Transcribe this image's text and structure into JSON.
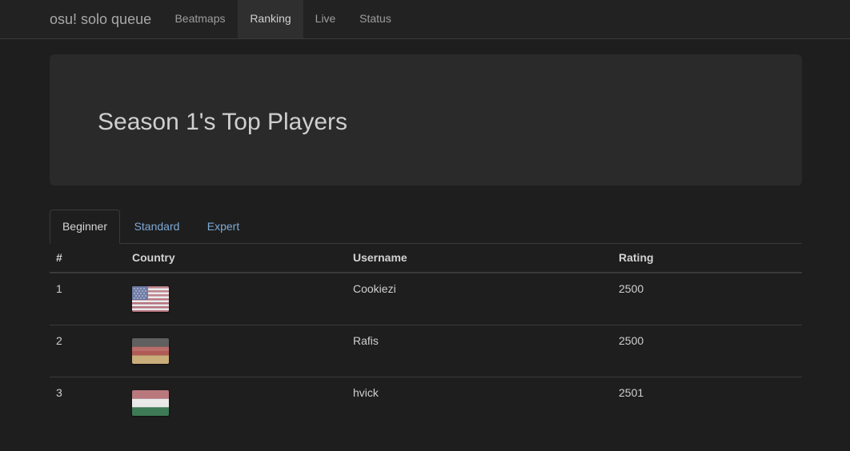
{
  "navbar": {
    "brand": "osu! solo queue",
    "items": [
      {
        "label": "Beatmaps",
        "active": false
      },
      {
        "label": "Ranking",
        "active": true
      },
      {
        "label": "Live",
        "active": false
      },
      {
        "label": "Status",
        "active": false
      }
    ]
  },
  "jumbotron": {
    "title": "Season 1's Top Players"
  },
  "tabs": [
    {
      "label": "Beginner",
      "active": true
    },
    {
      "label": "Standard",
      "active": false
    },
    {
      "label": "Expert",
      "active": false
    }
  ],
  "table": {
    "headers": [
      "#",
      "Country",
      "Username",
      "Rating"
    ],
    "rows": [
      {
        "rank": "1",
        "country_flag": "us-flag-icon",
        "username": "Cookiezi",
        "rating": "2500"
      },
      {
        "rank": "2",
        "country_flag": "de-flag-icon",
        "username": "Rafis",
        "rating": "2500"
      },
      {
        "rank": "3",
        "country_flag": "hu-flag-icon",
        "username": "hvick",
        "rating": "2501"
      }
    ]
  },
  "colors": {
    "background": "#1e1e1e",
    "navbar": "#222222",
    "jumbotron": "#2a2a2a",
    "link": "#7eaad6"
  }
}
